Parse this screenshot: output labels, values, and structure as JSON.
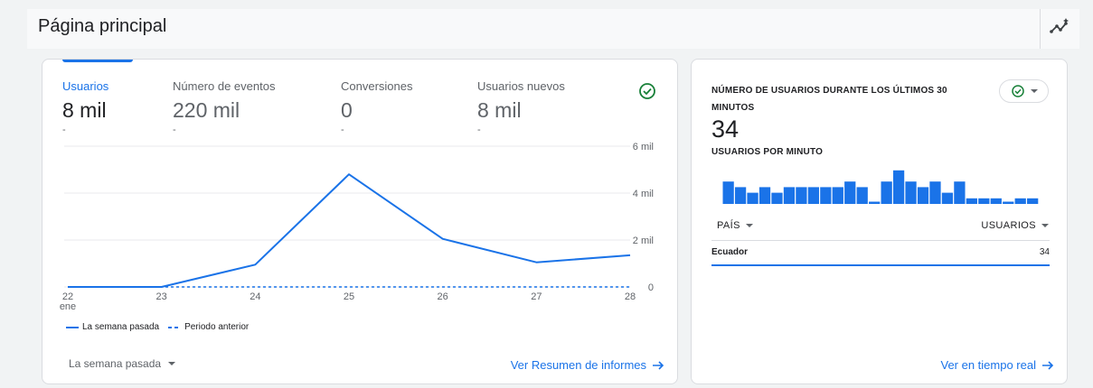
{
  "header": {
    "title": "Página principal",
    "insights_icon": "insights-sparkle-icon"
  },
  "colors": {
    "accent": "#1a73e8",
    "success": "#188038",
    "muted": "#5f6368",
    "border": "#dadce0"
  },
  "summary_card": {
    "metrics": [
      {
        "label": "Usuarios",
        "value": "8 mil",
        "change": "-",
        "active": true
      },
      {
        "label": "Número de eventos",
        "value": "220 mil",
        "change": "-",
        "active": false
      },
      {
        "label": "Conversiones",
        "value": "0",
        "change": "-",
        "active": false
      },
      {
        "label": "Usuarios nuevos",
        "value": "8 mil",
        "change": "-",
        "active": false
      }
    ],
    "status_icon": "check-circle-icon",
    "legend": {
      "current": "La semana pasada",
      "previous": "Periodo anterior"
    },
    "period_selector": "La semana pasada",
    "report_link": "Ver Resumen de informes",
    "link_icon": "arrow-right-icon"
  },
  "chart_data": {
    "type": "line",
    "x": [
      "22",
      "23",
      "24",
      "25",
      "26",
      "27",
      "28"
    ],
    "x_sublabel": "ene",
    "y_ticks": [
      "0",
      "2 mil",
      "4 mil",
      "6 mil"
    ],
    "ylim": [
      0,
      6000
    ],
    "grid": true,
    "legend_position": "bottom-left",
    "series": [
      {
        "name": "La semana pasada",
        "style": "solid",
        "values": [
          0,
          0,
          950,
          4800,
          2050,
          1050,
          1350
        ]
      },
      {
        "name": "Periodo anterior",
        "style": "dashed",
        "values": [
          0,
          0,
          0,
          0,
          0,
          0,
          0
        ]
      }
    ]
  },
  "realtime_card": {
    "title": "NÚMERO DE USUARIOS DURANTE LOS ÚLTIMOS 30 MINUTOS",
    "count": "34",
    "per_minute_label": "USUARIOS POR MINUTO",
    "per_minute_values": [
      4,
      3,
      2,
      3,
      2,
      3,
      3,
      3,
      3,
      3,
      4,
      3,
      0,
      4,
      6,
      4,
      3,
      4,
      2,
      4,
      1,
      1,
      1,
      0,
      1,
      1
    ],
    "chip_icon": "check-circle-icon",
    "table": {
      "col_country": "PAÍS",
      "col_users": "USUARIOS",
      "rows": [
        {
          "country": "Ecuador",
          "users": "34"
        }
      ]
    },
    "realtime_link": "Ver en tiempo real"
  }
}
